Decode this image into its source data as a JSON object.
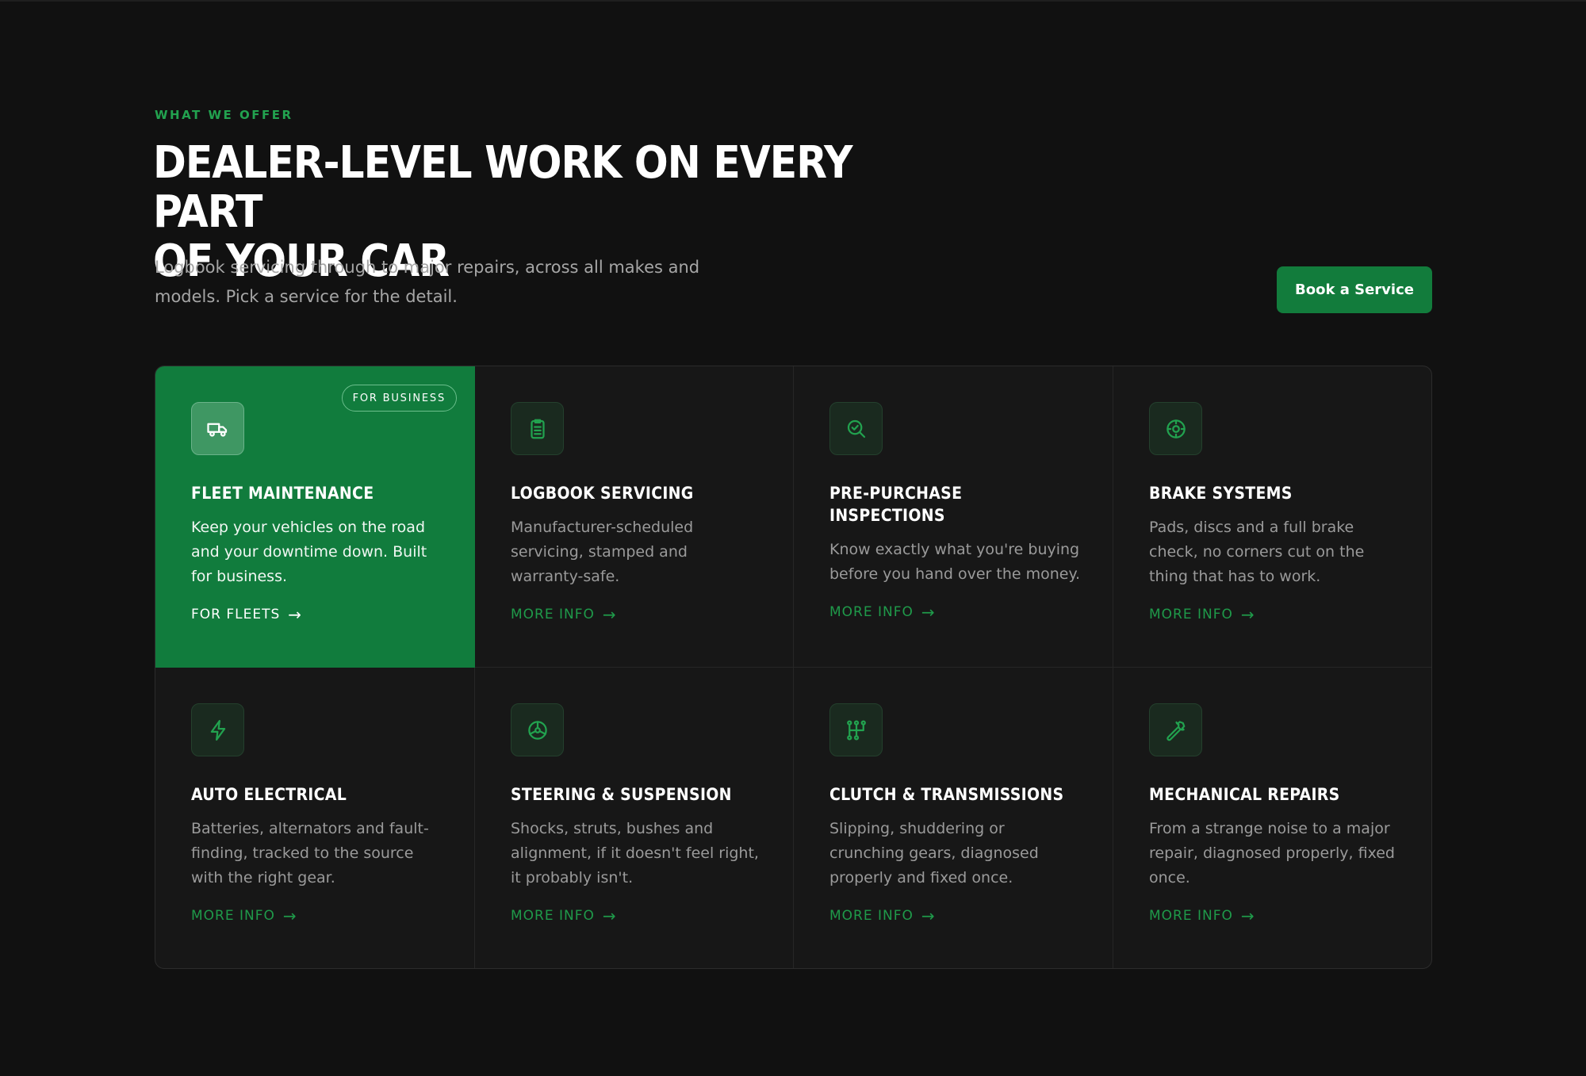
{
  "section": {
    "eyebrow": "WHAT WE OFFER",
    "heading_line1": "DEALER-LEVEL WORK ON EVERY PART",
    "heading_line2": "OF YOUR CAR",
    "subtitle": "Logbook servicing through to major repairs, across all makes and models. Pick a service for the detail.",
    "cta_label": "Book a Service"
  },
  "colors": {
    "background": "#111111",
    "accent": "#127c3c",
    "accent_text": "#22a24f",
    "card_bg": "#171717"
  },
  "services": [
    {
      "title": "FLEET MAINTENANCE",
      "description": "Keep your vehicles on the road and your downtime down. Built for business.",
      "link_label": "FOR FLEETS",
      "badge": "FOR BUSINESS",
      "icon": "truck-icon",
      "featured": true
    },
    {
      "title": "LOGBOOK SERVICING",
      "description": "Manufacturer-scheduled servicing, stamped and warranty-safe.",
      "link_label": "MORE INFO",
      "icon": "clipboard-icon"
    },
    {
      "title": "PRE-PURCHASE INSPECTIONS",
      "description": "Know exactly what you're buying before you hand over the money.",
      "link_label": "MORE INFO",
      "icon": "search-check-icon"
    },
    {
      "title": "BRAKE SYSTEMS",
      "description": "Pads, discs and a full brake check, no corners cut on the thing that has to work.",
      "link_label": "MORE INFO",
      "icon": "brake-disc-icon"
    },
    {
      "title": "AUTO ELECTRICAL",
      "description": "Batteries, alternators and fault-finding, tracked to the source with the right gear.",
      "link_label": "MORE INFO",
      "icon": "lightning-icon"
    },
    {
      "title": "STEERING & SUSPENSION",
      "description": "Shocks, struts, bushes and alignment, if it doesn't feel right, it probably isn't.",
      "link_label": "MORE INFO",
      "icon": "steering-wheel-icon"
    },
    {
      "title": "CLUTCH & TRANSMISSIONS",
      "description": "Slipping, shuddering or crunching gears, diagnosed properly and fixed once.",
      "link_label": "MORE INFO",
      "icon": "gear-shift-icon"
    },
    {
      "title": "MECHANICAL REPAIRS",
      "description": "From a strange noise to a major repair, diagnosed properly, fixed once.",
      "link_label": "MORE INFO",
      "icon": "wrench-icon"
    }
  ]
}
